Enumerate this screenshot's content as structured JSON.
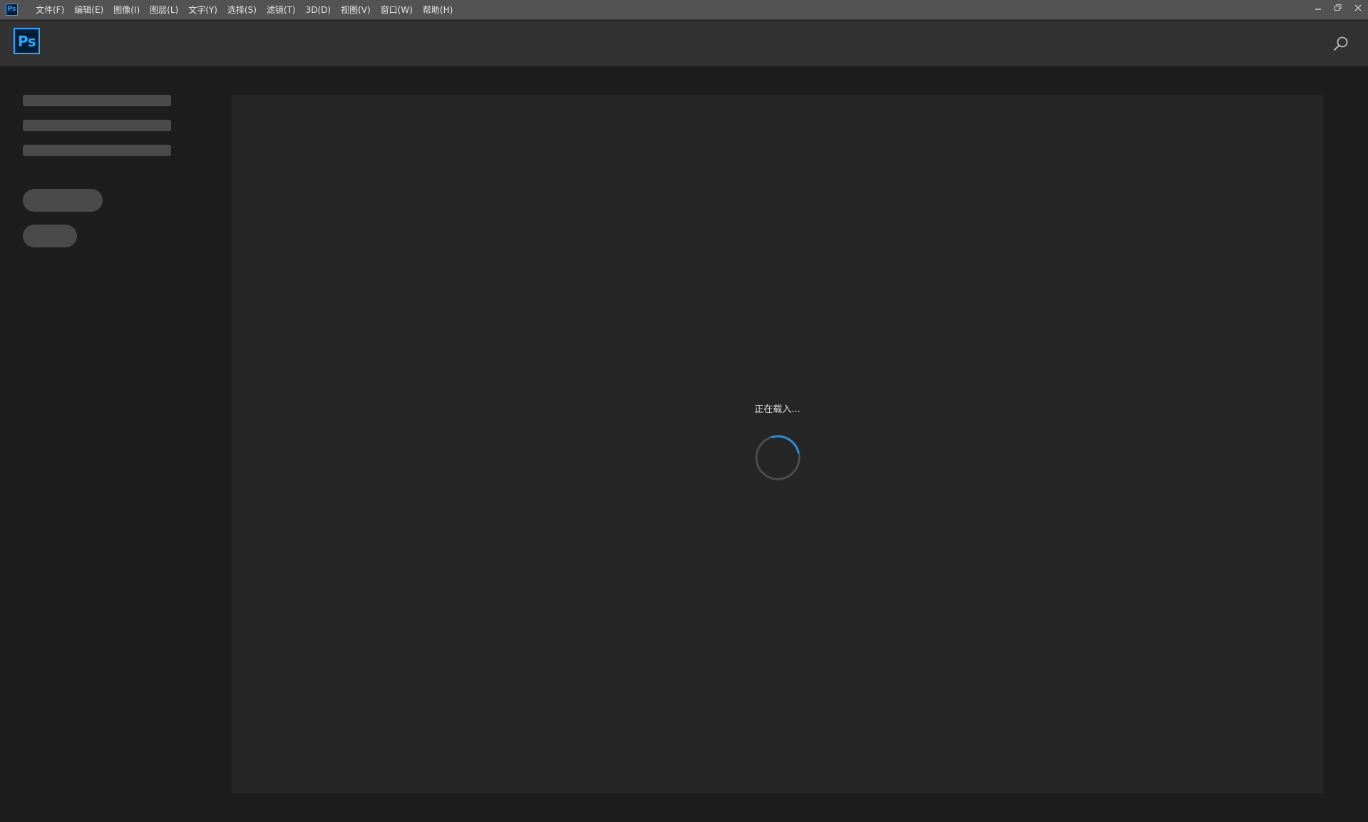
{
  "app": {
    "icon_label": "Ps",
    "logo_label": "Ps"
  },
  "menu": {
    "items": [
      "文件(F)",
      "编辑(E)",
      "图像(I)",
      "图层(L)",
      "文字(Y)",
      "选择(S)",
      "滤镜(T)",
      "3D(D)",
      "视图(V)",
      "窗口(W)",
      "帮助(H)"
    ]
  },
  "window_controls": [
    "minimize-icon",
    "restore-icon",
    "close-icon"
  ],
  "header": {
    "search_icon": "search-icon"
  },
  "content": {
    "loading_text": "正在载入..."
  },
  "colors": {
    "accent": "#31a8ff",
    "spinner_active": "#2b8cd6",
    "menubar_bg": "#535353",
    "header_bg": "#323232",
    "page_bg": "#1d1d1d",
    "panel_bg": "#262626",
    "skeleton": "#4a4a4a"
  }
}
